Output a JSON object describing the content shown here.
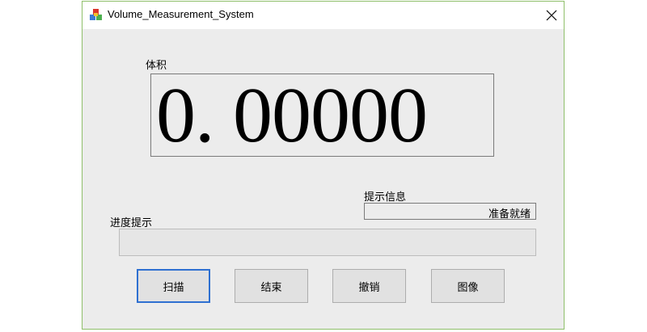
{
  "window": {
    "title": "Volume_Measurement_System",
    "app_icon": "colored-blocks-icon",
    "close_icon": "close-icon"
  },
  "volume": {
    "label": "体积",
    "value": "0. 00000"
  },
  "status": {
    "label": "提示信息",
    "text": "准备就绪"
  },
  "progress": {
    "label": "进度提示",
    "value": 0
  },
  "buttons": {
    "scan": "扫描",
    "end": "结束",
    "cancel": "撤销",
    "image": "图像"
  },
  "colors": {
    "window_border": "#8fbf6a",
    "focus_border": "#2e70d1",
    "background": "#ececec"
  }
}
